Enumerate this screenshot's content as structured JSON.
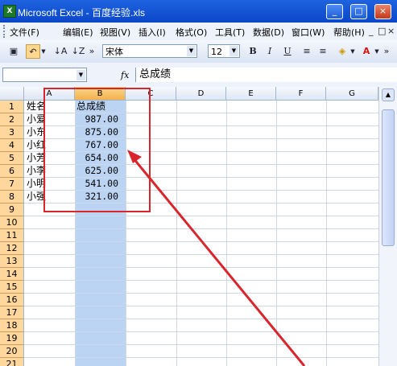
{
  "window": {
    "title": "Microsoft Excel - 百度经验.xls",
    "app_icon": "excel-icon",
    "controls": [
      "_",
      "□",
      "×"
    ]
  },
  "menu": {
    "items": [
      "文件(F)",
      "编辑(E)",
      "视图(V)",
      "插入(I)",
      "格式(O)",
      "工具(T)",
      "数据(D)",
      "窗口(W)",
      "帮助(H)"
    ],
    "doc_controls": [
      "_",
      "□",
      "×"
    ]
  },
  "toolbar": {
    "font_name": "宋体",
    "font_size": "12",
    "bold_label": "B",
    "italic_label": "I",
    "underline_label": "U",
    "font_color_label": "A"
  },
  "formula_bar": {
    "name_box": "",
    "fx_label": "fx",
    "content": "总成绩"
  },
  "sheet": {
    "columns": [
      "A",
      "B",
      "C",
      "D",
      "E",
      "F",
      "G"
    ],
    "selected_column": "B",
    "row_numbers": [
      "1",
      "2",
      "3",
      "4",
      "5",
      "6",
      "7",
      "8",
      "9",
      "10",
      "11",
      "12",
      "13",
      "14",
      "15",
      "16",
      "17",
      "18",
      "19",
      "20",
      "21"
    ],
    "names": [
      "姓名",
      "小爱",
      "小东",
      "小红",
      "小芳",
      "小李",
      "小明",
      "小强"
    ],
    "scores": [
      "总成绩",
      "987.00",
      "875.00",
      "767.00",
      "654.00",
      "625.00",
      "541.00",
      "321.00"
    ]
  },
  "annotation": {
    "color": "#d9262c"
  }
}
